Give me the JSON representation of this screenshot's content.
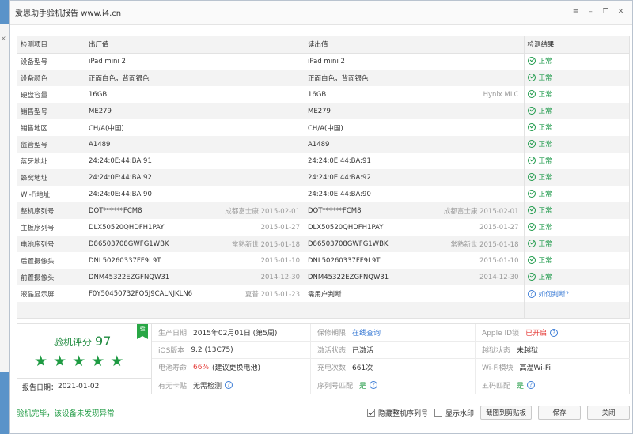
{
  "background_window": {
    "close_glyph": "×"
  },
  "window": {
    "title": "爱思助手验机报告 www.i4.cn",
    "controls": [
      "menu-icon",
      "minimize-icon",
      "restore-icon",
      "close-icon"
    ]
  },
  "table": {
    "headers": [
      "检测项目",
      "出厂值",
      "读出值",
      "检测结果"
    ],
    "rows": [
      {
        "item": "设备型号",
        "factory": "iPad mini 2",
        "factory_note": "",
        "read": "iPad mini 2",
        "read_note": "",
        "result": "正常"
      },
      {
        "item": "设备颜色",
        "factory": "正面白色，背面银色",
        "factory_note": "",
        "read": "正面白色，背面银色",
        "read_note": "",
        "result": "正常"
      },
      {
        "item": "硬盘容量",
        "factory": "16GB",
        "factory_note": "",
        "read": "16GB",
        "read_note": "Hynix MLC",
        "result": "正常"
      },
      {
        "item": "销售型号",
        "factory": "ME279",
        "factory_note": "",
        "read": "ME279",
        "read_note": "",
        "result": "正常"
      },
      {
        "item": "销售地区",
        "factory": "CH/A(中国)",
        "factory_note": "",
        "read": "CH/A(中国)",
        "read_note": "",
        "result": "正常"
      },
      {
        "item": "监管型号",
        "factory": "A1489",
        "factory_note": "",
        "read": "A1489",
        "read_note": "",
        "result": "正常"
      },
      {
        "item": "蓝牙地址",
        "factory": "24:24:0E:44:BA:91",
        "factory_note": "",
        "read": "24:24:0E:44:BA:91",
        "read_note": "",
        "result": "正常"
      },
      {
        "item": "蜂窝地址",
        "factory": "24:24:0E:44:BA:92",
        "factory_note": "",
        "read": "24:24:0E:44:BA:92",
        "read_note": "",
        "result": "正常"
      },
      {
        "item": "Wi-Fi地址",
        "factory": "24:24:0E:44:BA:90",
        "factory_note": "",
        "read": "24:24:0E:44:BA:90",
        "read_note": "",
        "result": "正常"
      },
      {
        "item": "整机序列号",
        "factory": "DQT******FCM8",
        "factory_note": "成都富士康 2015-02-01",
        "read": "DQT******FCM8",
        "read_note": "成都富士康 2015-02-01",
        "result": "正常"
      },
      {
        "item": "主板序列号",
        "factory": "DLX50520QHDFH1PAY",
        "factory_note": "2015-01-27",
        "read": "DLX50520QHDFH1PAY",
        "read_note": "2015-01-27",
        "result": "正常"
      },
      {
        "item": "电池序列号",
        "factory": "D86503708GWFG1WBK",
        "factory_note": "常熟新世 2015-01-18",
        "read": "D86503708GWFG1WBK",
        "read_note": "常熟新世 2015-01-18",
        "result": "正常"
      },
      {
        "item": "后置摄像头",
        "factory": "DNL50260337FF9L9T",
        "factory_note": "2015-01-10",
        "read": "DNL50260337FF9L9T",
        "read_note": "2015-01-10",
        "result": "正常"
      },
      {
        "item": "前置摄像头",
        "factory": "DNM45322EZGFNQW31",
        "factory_note": "2014-12-30",
        "read": "DNM45322EZGFNQW31",
        "read_note": "2014-12-30",
        "result": "正常"
      },
      {
        "item": "液晶显示屏",
        "factory": "F0Y50450732FQ5J9CALNJKLN6",
        "factory_note": "夏普 2015-01-23",
        "read": "需用户判断",
        "read_note": "",
        "result": "如何判断?",
        "result_type": "help"
      },
      {
        "item": "",
        "factory": "",
        "factory_note": "",
        "read": "",
        "read_note": "",
        "result": "",
        "result_type": "empty"
      }
    ]
  },
  "score": {
    "badge": "验",
    "label": "验机评分",
    "value": "97",
    "stars": 5,
    "star_glyph": "★",
    "report_date_label": "报告日期：",
    "report_date": "2021-01-02"
  },
  "info": {
    "rows": [
      [
        {
          "label": "生产日期",
          "value": "2015年02月01日 (第5周)"
        },
        {
          "label": "保修期限",
          "value": "在线查询",
          "tone": "blue"
        },
        {
          "label": "Apple ID锁",
          "value": "已开启",
          "tone": "red",
          "help": true
        }
      ],
      [
        {
          "label": "iOS版本",
          "value": "9.2 (13C75)"
        },
        {
          "label": "激活状态",
          "value": "已激活"
        },
        {
          "label": "越狱状态",
          "value": "未越狱"
        }
      ],
      [
        {
          "label": "电池寿命",
          "value_red": "66%",
          "value": "(建议更换电池)"
        },
        {
          "label": "充电次数",
          "value": "661次"
        },
        {
          "label": "Wi-Fi模块",
          "value": "高温Wi-Fi"
        }
      ],
      [
        {
          "label": "有无卡贴",
          "value": "无需检测",
          "help": true
        },
        {
          "label": "序列号匹配",
          "value": "是",
          "tone": "green",
          "help": true
        },
        {
          "label": "五码匹配",
          "value": "是",
          "tone": "green",
          "help": true
        }
      ]
    ]
  },
  "footer": {
    "status": "验机完毕，该设备未发现异常",
    "hide_serial_label": "隐藏整机序列号",
    "hide_serial_checked": true,
    "watermark_label": "显示水印",
    "watermark_checked": false,
    "copy_button": "截图到剪贴板",
    "save_button": "保存",
    "close_button": "关闭"
  },
  "colors": {
    "ok_green": "#1f9a4b",
    "link_blue": "#3a7bd5",
    "alert_red": "#e53935",
    "desktop_blue": "#5a93c9"
  }
}
